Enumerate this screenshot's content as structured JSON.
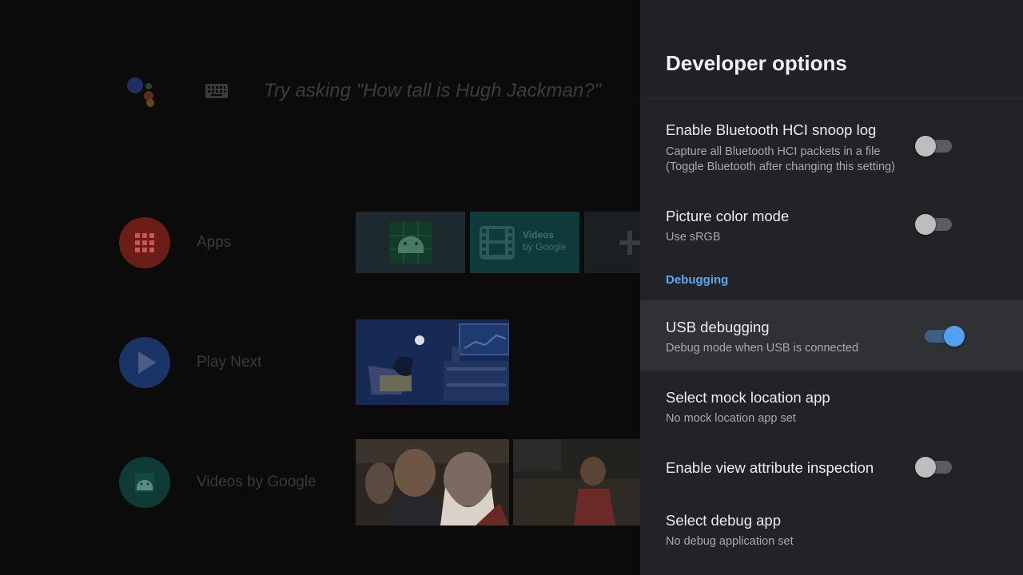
{
  "launcher": {
    "search_hint": "Try asking \"How tall is Hugh Jackman?\"",
    "rows": [
      {
        "label": "Apps",
        "icon": "apps-grid-icon",
        "color": "#6b1d17"
      },
      {
        "label": "Play Next",
        "icon": "play-icon",
        "color": "#1b3466"
      },
      {
        "label": "Videos by Google",
        "icon": "android-icon",
        "color": "#0f3a36"
      }
    ],
    "apps_tile_text": {
      "title": "Videos",
      "subtitle": "by Google"
    }
  },
  "panel": {
    "title": "Developer options",
    "items": [
      {
        "title": "Enable Bluetooth HCI snoop log",
        "summary_line1": "Capture all Bluetooth HCI packets in a file",
        "summary_line2": "(Toggle Bluetooth after changing this setting)",
        "toggle": false
      },
      {
        "title": "Picture color mode",
        "summary": "Use sRGB",
        "toggle": false
      },
      {
        "category": "Debugging"
      },
      {
        "title": "USB debugging",
        "summary": "Debug mode when USB is connected",
        "toggle": true,
        "focused": true
      },
      {
        "title": "Select mock location app",
        "summary": "No mock location app set"
      },
      {
        "title": "Enable view attribute inspection",
        "toggle": false
      },
      {
        "title": "Select debug app",
        "summary": "No debug application set"
      }
    ],
    "accent_color": "#52a0f3"
  }
}
